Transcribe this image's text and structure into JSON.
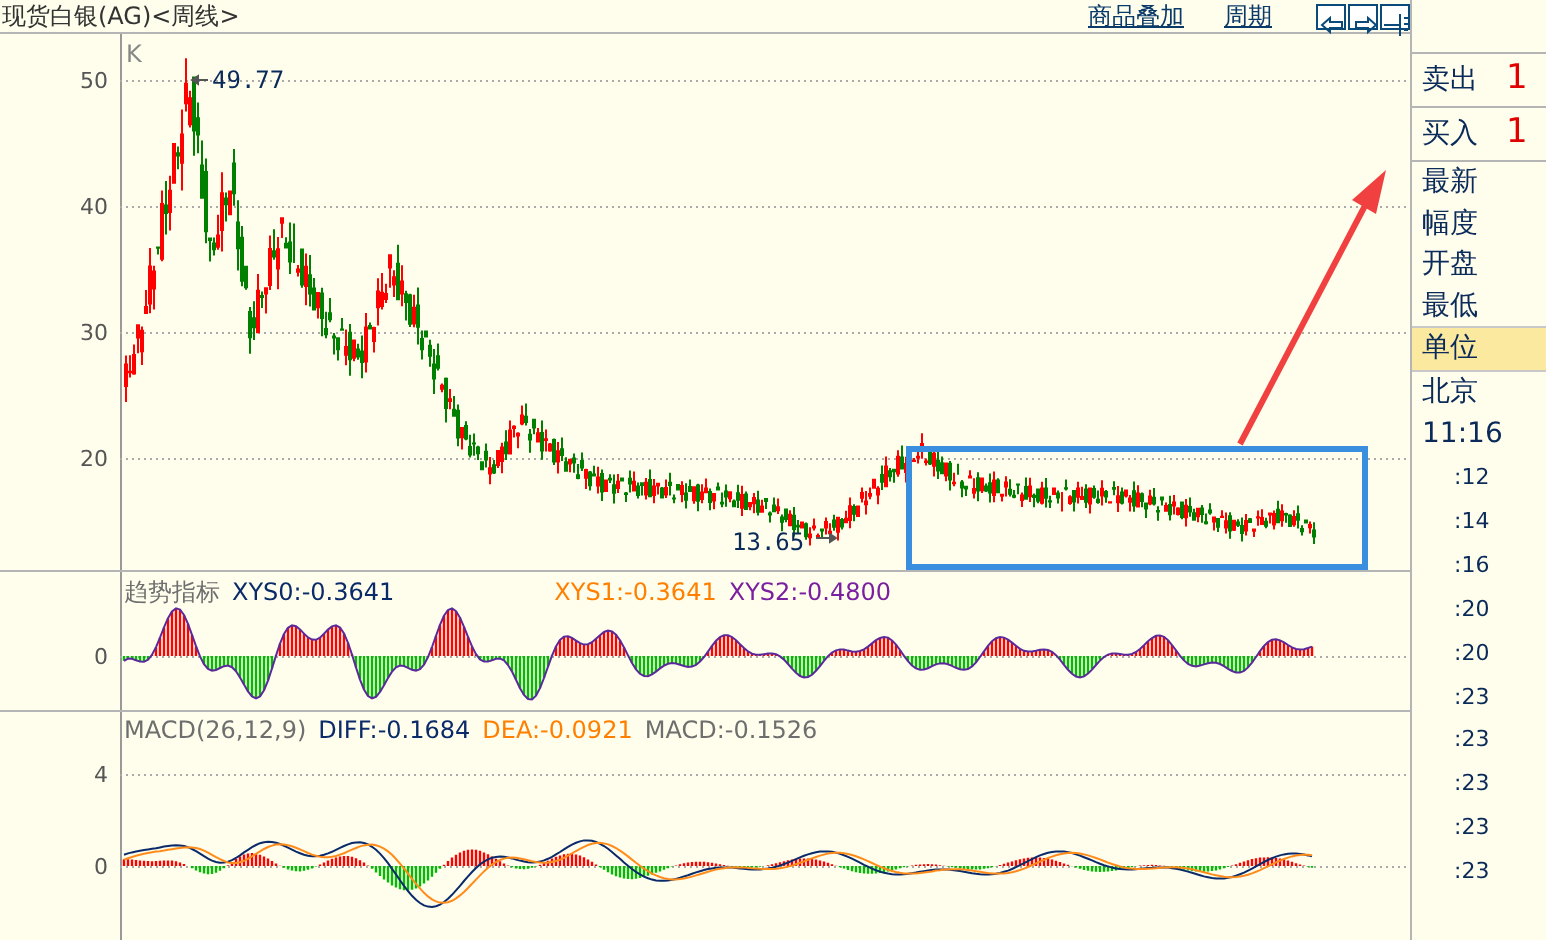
{
  "header": {
    "title": "现货白银(AG)<周线>",
    "links": [
      "商品叠加",
      "周期"
    ]
  },
  "k_panel": {
    "label": "K",
    "y_labels": [
      "50",
      "40",
      "30",
      "20"
    ],
    "max_label": "49.77",
    "min_label": "13.65"
  },
  "trend_panel": {
    "y_label": "0",
    "legend": [
      {
        "label": "趋势指标",
        "color": "#6e6e6e"
      },
      {
        "label": "XYS0:-0.3641",
        "color": "#0a2a6a"
      },
      {
        "label": "XYS1:-0.3641",
        "color": "#ff8000"
      },
      {
        "label": "XYS2:-0.4800",
        "color": "#7a1fa0"
      }
    ]
  },
  "macd_panel": {
    "y_labels": [
      "4",
      "0"
    ],
    "legend": [
      {
        "label": "MACD(26,12,9)",
        "color": "#6e6e6e"
      },
      {
        "label": "DIFF:-0.1684",
        "color": "#0a2a6a"
      },
      {
        "label": "DEA:-0.0921",
        "color": "#ff8000"
      },
      {
        "label": "MACD:-0.1526",
        "color": "#6e6e6e"
      }
    ]
  },
  "quote_panel": {
    "trades": [
      {
        "label": "卖出",
        "value": "1"
      },
      {
        "label": "买入",
        "value": "1"
      }
    ],
    "fields": [
      {
        "label": "最新",
        "selected": false
      },
      {
        "label": "幅度",
        "selected": false
      },
      {
        "label": "开盘",
        "selected": false
      },
      {
        "label": "最低",
        "selected": false
      },
      {
        "label": "单位",
        "selected": true
      },
      {
        "label": "北京",
        "selected": false
      }
    ],
    "time": "11:16",
    "ticks": [
      ":12",
      ":14",
      ":16",
      ":20",
      ":20",
      ":23",
      ":23",
      ":23",
      ":23",
      ":23"
    ]
  }
}
